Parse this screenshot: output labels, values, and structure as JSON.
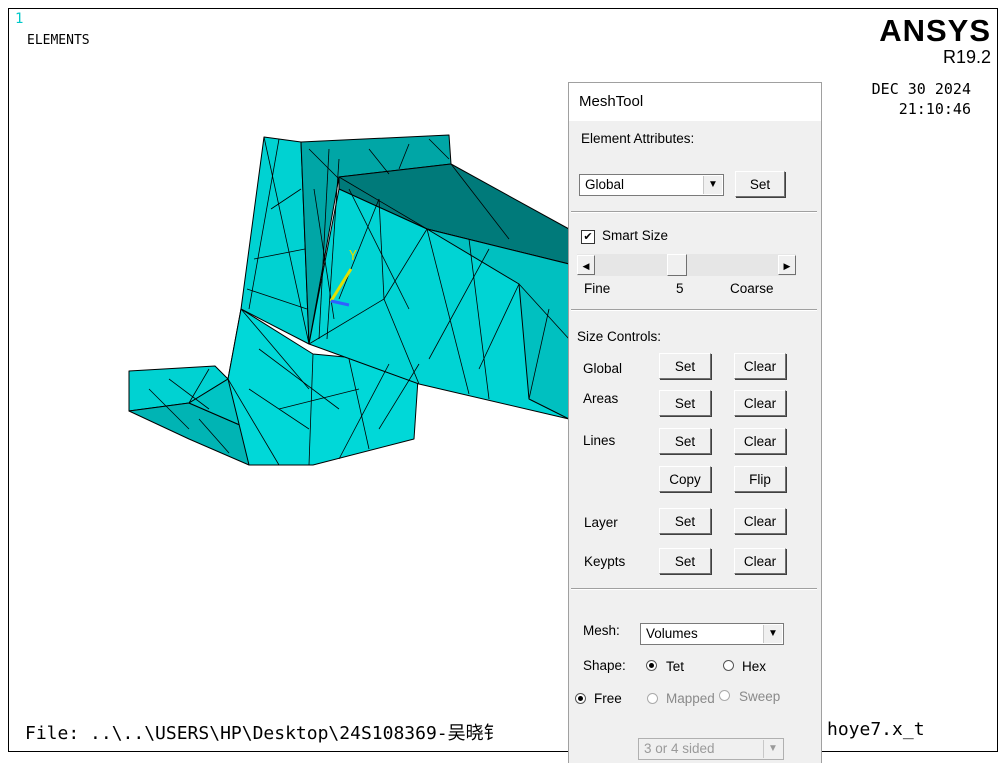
{
  "viewport": {
    "window_number": "1",
    "plot_label": "ELEMENTS",
    "brand": "ANSYS",
    "version": "R19.2",
    "date": "DEC 30 2024",
    "time": "21:10:46",
    "file_line": "File: ..\\..\\USERS\\HP\\Desktop\\24S108369-吴晓钅",
    "file_line_tail": "hoye7.x_t",
    "axis_y_label": "Y",
    "mesh_color": "#00d2d2",
    "mesh_shade_color": "#008c8c"
  },
  "meshtool": {
    "title": "MeshTool",
    "element_attributes_label": "Element Attributes:",
    "element_attributes_value": "Global",
    "element_attributes_set": "Set",
    "smart_size_label": "Smart Size",
    "smart_size_checked": true,
    "slider_fine": "Fine",
    "slider_value": "5",
    "slider_coarse": "Coarse",
    "slider_level": 5,
    "size_controls_label": "Size Controls:",
    "rows": {
      "global": {
        "label": "Global",
        "set": "Set",
        "clear": "Clear"
      },
      "areas": {
        "label": "Areas",
        "set": "Set",
        "clear": "Clear"
      },
      "lines": {
        "label": "Lines",
        "set": "Set",
        "clear": "Clear"
      },
      "copy_flip": {
        "copy": "Copy",
        "flip": "Flip"
      },
      "layer": {
        "label": "Layer",
        "set": "Set",
        "clear": "Clear"
      },
      "keypts": {
        "label": "Keypts",
        "set": "Set",
        "clear": "Clear"
      }
    },
    "mesh_label": "Mesh:",
    "mesh_value": "Volumes",
    "shape_label": "Shape:",
    "shape_tet": "Tet",
    "shape_hex": "Hex",
    "free_label": "Free",
    "mapped_label": "Mapped",
    "sweep_label": "Sweep",
    "sided_value": "3 or 4 sided"
  }
}
